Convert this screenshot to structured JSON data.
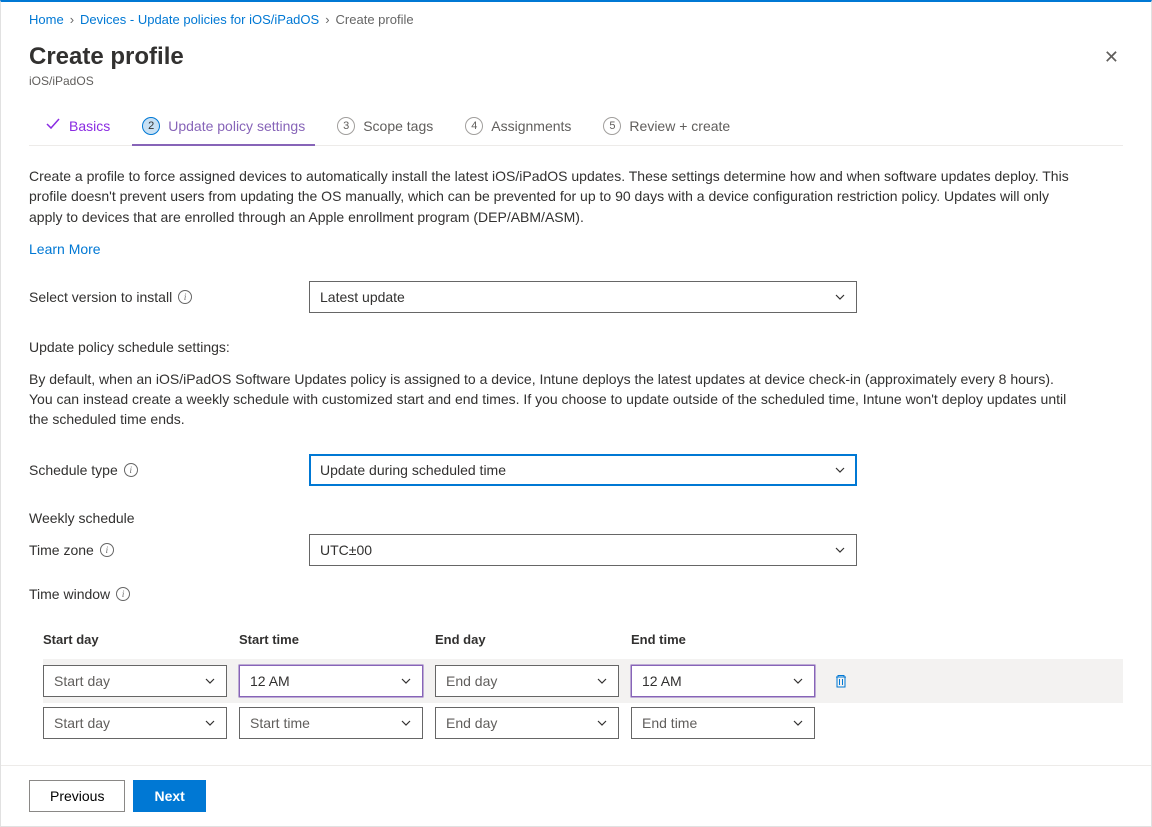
{
  "breadcrumb": {
    "home": "Home",
    "devices": "Devices - Update policies for iOS/iPadOS",
    "current": "Create profile"
  },
  "header": {
    "title": "Create profile",
    "subtitle": "iOS/iPadOS"
  },
  "tabs": {
    "basics": "Basics",
    "update": "Update policy settings",
    "scope": "Scope tags",
    "assignments": "Assignments",
    "review": "Review + create"
  },
  "main": {
    "description": "Create a profile to force assigned devices to automatically install the latest iOS/iPadOS updates. These settings determine how and when software updates deploy. This profile doesn't prevent users from updating the OS manually, which can be prevented for up to 90 days with a device configuration restriction policy. Updates will only apply to devices that are enrolled through an Apple enrollment program (DEP/ABM/ASM).",
    "learn_more": "Learn More",
    "version_label": "Select version to install",
    "version_value": "Latest update",
    "schedule_heading": "Update policy schedule settings:",
    "schedule_desc": "By default, when an iOS/iPadOS Software Updates policy is assigned to a device, Intune deploys the latest updates at device check-in (approximately every 8 hours). You can instead create a weekly schedule with customized start and end times. If you choose to update outside of the scheduled time, Intune won't deploy updates until the scheduled time ends.",
    "schedule_type_label": "Schedule type",
    "schedule_type_value": "Update during scheduled time",
    "weekly_heading": "Weekly schedule",
    "timezone_label": "Time zone",
    "timezone_value": "UTC±00",
    "timewindow_label": "Time window"
  },
  "table": {
    "headers": {
      "start_day": "Start day",
      "start_time": "Start time",
      "end_day": "End day",
      "end_time": "End time"
    },
    "rows": [
      {
        "start_day": "Start day",
        "start_time": "12 AM",
        "end_day": "End day",
        "end_time": "12 AM"
      },
      {
        "start_day": "Start day",
        "start_time": "Start time",
        "end_day": "End day",
        "end_time": "End time"
      }
    ]
  },
  "footer": {
    "previous": "Previous",
    "next": "Next"
  }
}
